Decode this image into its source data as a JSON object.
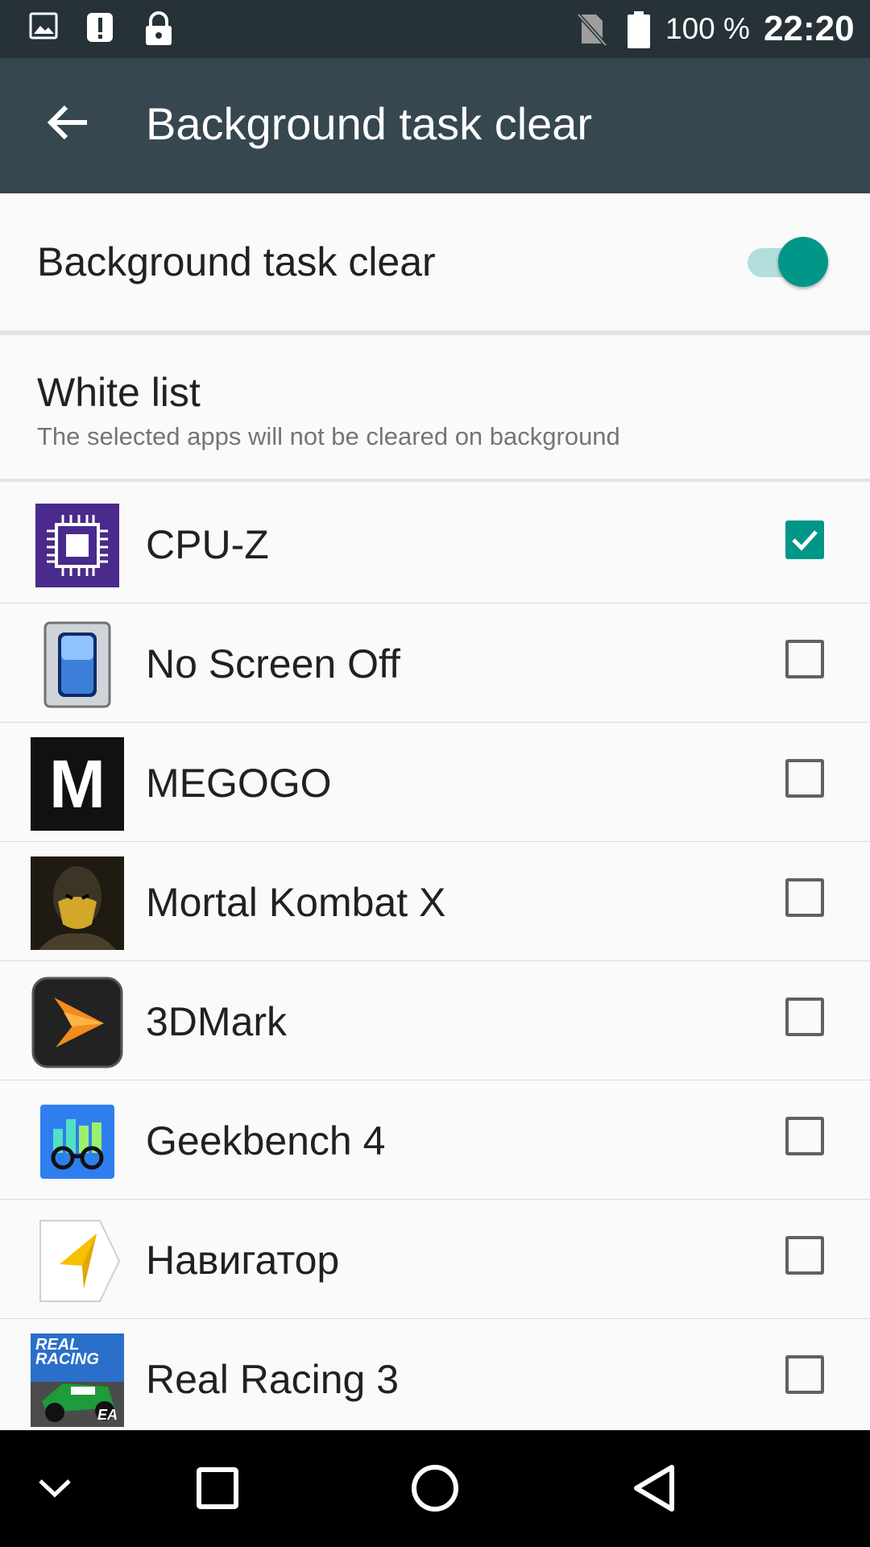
{
  "status_bar": {
    "battery_percent": "100 %",
    "time": "22:20",
    "icons": [
      "image-icon",
      "alert-icon",
      "lock-icon",
      "no-sim-icon",
      "battery-icon"
    ]
  },
  "app_bar": {
    "title": "Background task clear",
    "back_icon": "arrow-back-icon"
  },
  "toggle": {
    "label": "Background task clear",
    "state": "on",
    "accent_color": "#009688"
  },
  "white_list": {
    "title": "White list",
    "subtitle": "The selected apps will not be cleared on background"
  },
  "apps": [
    {
      "name": "CPU-Z",
      "checked": true,
      "icon": "cpu-z-icon"
    },
    {
      "name": "No Screen Off",
      "checked": false,
      "icon": "no-screen-off-icon"
    },
    {
      "name": "MEGOGO",
      "checked": false,
      "icon": "megogo-icon"
    },
    {
      "name": "Mortal Kombat X",
      "checked": false,
      "icon": "mortal-kombat-icon"
    },
    {
      "name": "3DMark",
      "checked": false,
      "icon": "3dmark-icon"
    },
    {
      "name": "Geekbench 4",
      "checked": false,
      "icon": "geekbench-icon"
    },
    {
      "name": "Навигатор",
      "checked": false,
      "icon": "navigator-icon"
    },
    {
      "name": "Real Racing 3",
      "checked": false,
      "icon": "real-racing-icon"
    }
  ],
  "icon_labels": {
    "megogo": "M",
    "real_racing_top": "REAL",
    "real_racing_bottom": "RACING",
    "ea": "EA"
  },
  "nav_bar": {
    "icons": [
      "chevron-down-icon",
      "recents-icon",
      "home-icon",
      "back-icon"
    ]
  }
}
